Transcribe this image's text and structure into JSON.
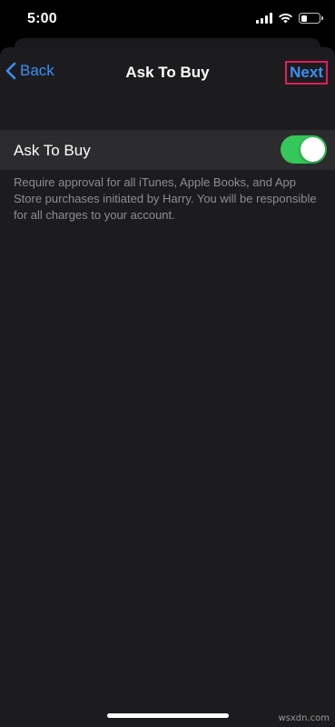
{
  "status_bar": {
    "time": "5:00",
    "icons": [
      "cellular-signal-icon",
      "wifi-icon",
      "battery-icon"
    ],
    "battery_level": 0.35
  },
  "navbar": {
    "back_label": "Back",
    "title": "Ask To Buy",
    "next_label": "Next"
  },
  "settings": {
    "ask_to_buy_label": "Ask To Buy",
    "ask_to_buy_enabled": true,
    "footnote": "Require approval for all iTunes, Apple Books, and App Store purchases initiated by Harry. You will be responsible for all charges to your account."
  },
  "watermark": "wsxdn.com",
  "colors": {
    "accent": "#3b8ff5",
    "toggle_on": "#34c759",
    "highlight": "#e11d5b",
    "background": "#1c1c1e"
  }
}
